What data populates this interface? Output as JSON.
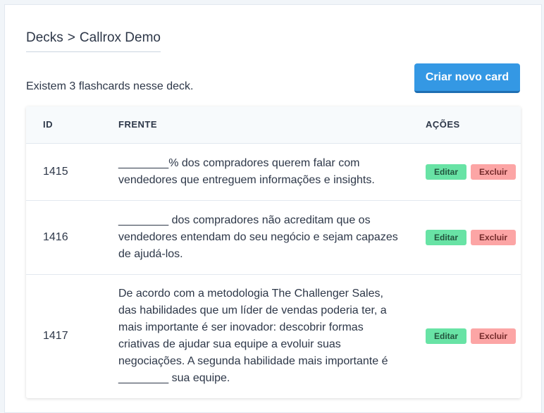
{
  "breadcrumb": {
    "parent": "Decks",
    "separator": ">",
    "current": "Callrox Demo"
  },
  "deck_info": {
    "count_text": "Existem 3 flashcards nesse deck."
  },
  "actions": {
    "create_label": "Criar novo card"
  },
  "table": {
    "headers": {
      "id": "ID",
      "front": "FRENTE",
      "actions": "AÇÕES"
    },
    "rows": [
      {
        "id": "1415",
        "front": "________% dos compradores querem falar com vendedores que entreguem informações e insights.",
        "edit_label": "Editar",
        "delete_label": "Excluir"
      },
      {
        "id": "1416",
        "front": "________ dos compradores não acreditam que os vendedores entendam do seu negócio e sejam capazes de ajudá-los.",
        "edit_label": "Editar",
        "delete_label": "Excluir"
      },
      {
        "id": "1417",
        "front": "De acordo com a metodologia The Challenger Sales, das habilidades que um líder de vendas poderia ter, a mais importante é ser inovador: descobrir formas criativas de ajudar sua equipe a evoluir suas negociações. A segunda habilidade mais importante é ________ sua equipe.",
        "edit_label": "Editar",
        "delete_label": "Excluir"
      }
    ]
  },
  "colors": {
    "primary": "#3498e4",
    "edit": "#68e3a5",
    "delete": "#fca5a5"
  }
}
